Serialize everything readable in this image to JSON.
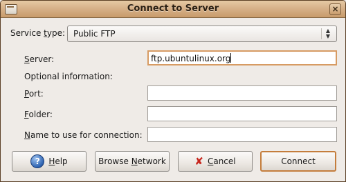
{
  "window": {
    "title": "Connect to Server"
  },
  "service_type": {
    "label_pre": "Service ",
    "label_mnemonic": "t",
    "label_post": "ype:",
    "selected": "Public FTP"
  },
  "fields": {
    "server": {
      "mnemonic": "S",
      "rest": "erver:",
      "value": "ftp.ubuntulinux.org"
    },
    "optional_heading": "Optional information:",
    "port": {
      "mnemonic": "P",
      "rest": "ort:",
      "value": ""
    },
    "folder": {
      "mnemonic": "F",
      "rest": "older:",
      "value": ""
    },
    "name": {
      "mnemonic": "N",
      "rest": "ame to use for connection:",
      "value": ""
    }
  },
  "buttons": {
    "help": {
      "mnemonic": "H",
      "rest": "elp"
    },
    "browse": {
      "pre": "Browse ",
      "mnemonic": "N",
      "rest": "etwork"
    },
    "cancel": {
      "mnemonic": "C",
      "rest": "ancel"
    },
    "connect": {
      "label": "Connect"
    }
  },
  "colors": {
    "titlebar": "#d7b28a",
    "focus_border": "#d79b63",
    "default_button_border": "#c47d3c"
  }
}
